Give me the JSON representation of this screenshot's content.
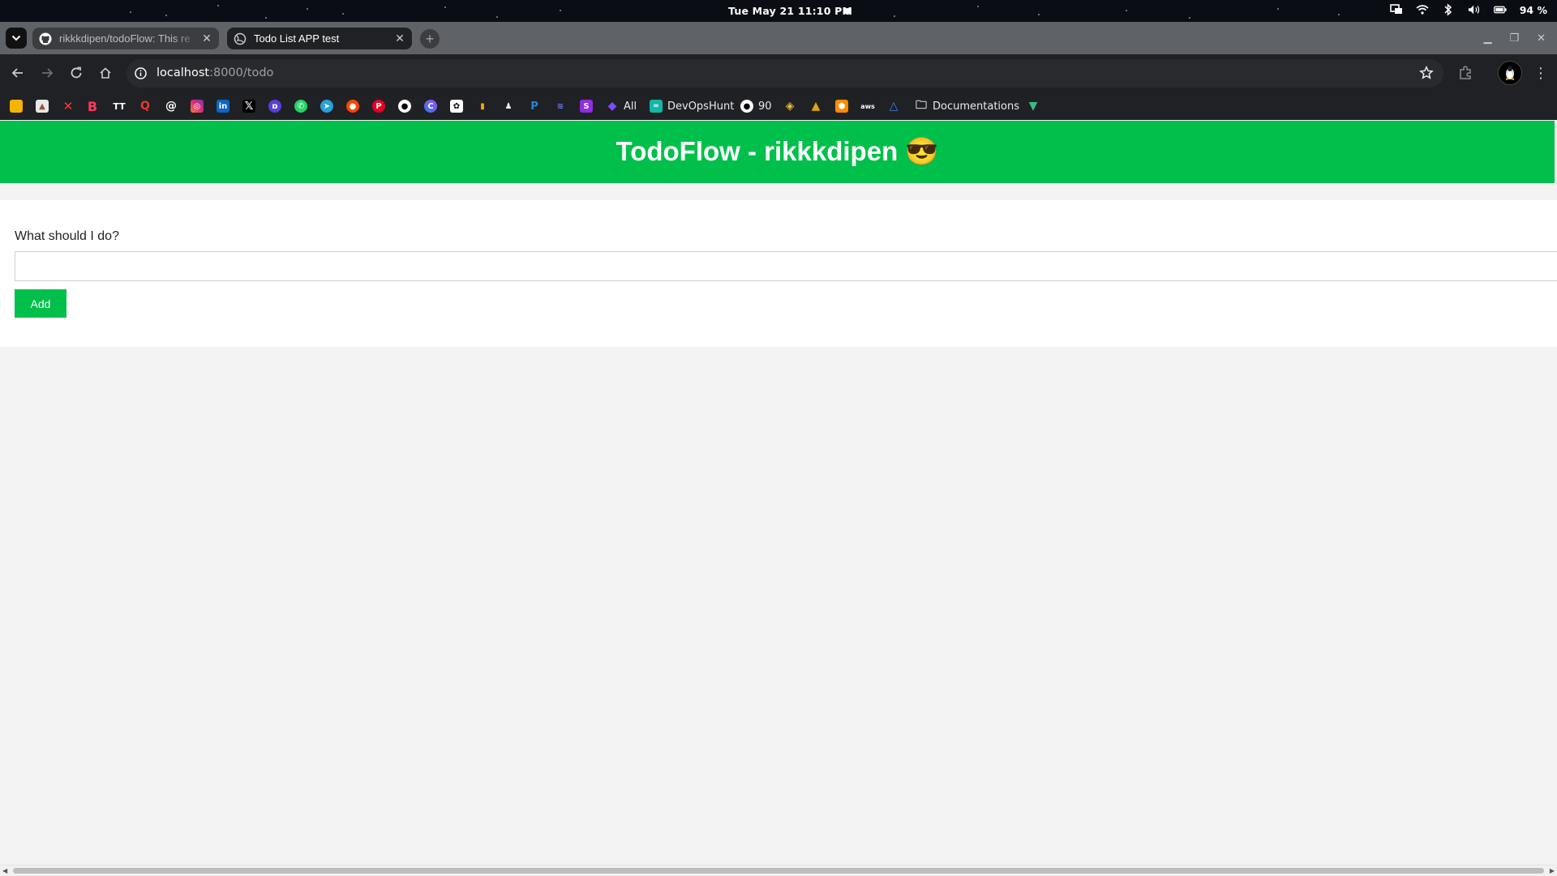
{
  "os": {
    "datetime": "Tue May 21  11:10 PM",
    "battery": "94 %",
    "icons": [
      "screen-share-icon",
      "wifi-icon",
      "bluetooth-icon",
      "volume-icon",
      "battery-icon"
    ]
  },
  "tabs": [
    {
      "title": "rikkkdipen/todoFlow: This re",
      "favicon": "github-icon",
      "active": false
    },
    {
      "title": "Todo List APP test",
      "favicon": "globe-icon",
      "active": true
    }
  ],
  "omnibox": {
    "host": "localhost",
    "path": ":8000/todo"
  },
  "bookmarks": {
    "all_label": "All",
    "devops_label": "DevOpsHunt",
    "github_count": "90",
    "docs_label": "Documentations"
  },
  "app": {
    "title": "TodoFlow - rikkkdipen 😎",
    "prompt_label": "What should I do?",
    "input_value": "",
    "input_placeholder": "",
    "add_label": "Add",
    "accent_color": "#00c04b"
  }
}
